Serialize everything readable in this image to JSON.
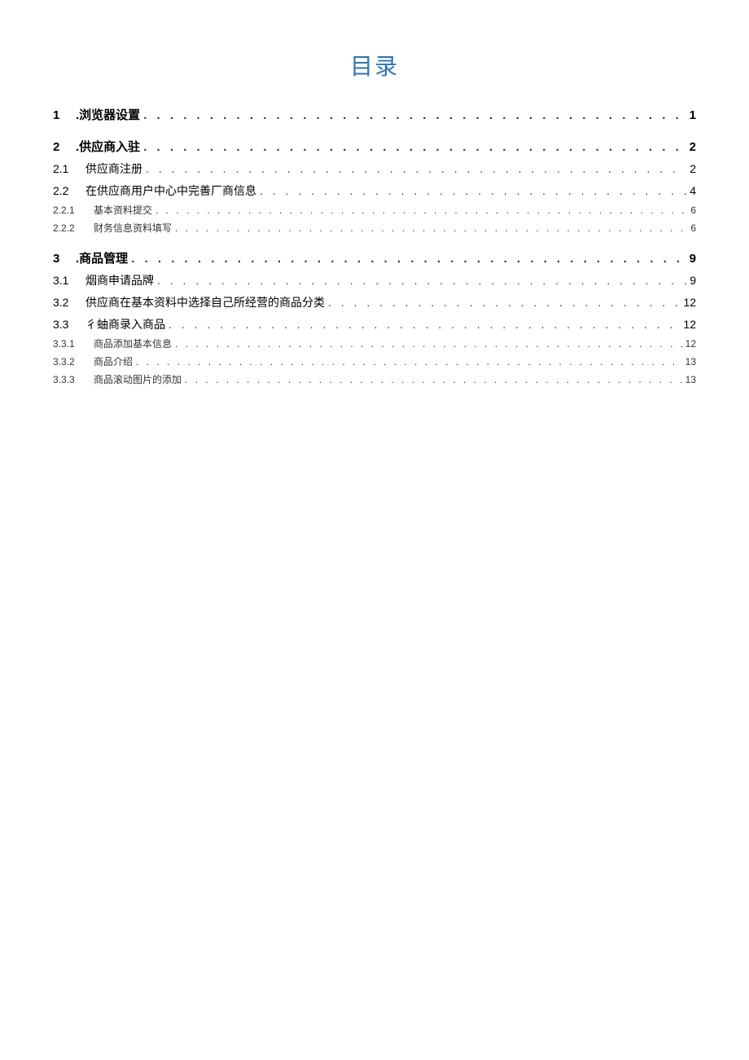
{
  "title": "目录",
  "leader": ". . . . . . . . . . . . . . . . . . . . . . . . . . . . . . . . . . . . . . . . . . . . . . . . . . . . . . . . . . . . . . . . . . . . . . . . . . . . . . . . . . . . . . . . . . . . . . . . . . . . . . . . . . . . . . . . . . . . . . . . . . . . . . . . . . . . . . . . . . . . . . . . . . . . . .",
  "entries": [
    {
      "level": 1,
      "num": "1",
      "dot": ".",
      "text": "浏览器设置",
      "page": "1"
    },
    {
      "level": 1,
      "num": "2",
      "dot": ". ",
      "text": "供应商入驻",
      "page": "2"
    },
    {
      "level": 2,
      "num": "2.1",
      "dot": "",
      "text": "供应商注册",
      "page": "2"
    },
    {
      "level": 2,
      "num": "2.2",
      "dot": "",
      "text": "在供应商用户中心中完善厂商信息",
      "page": "4"
    },
    {
      "level": 3,
      "num": "2.2.1",
      "dot": "",
      "text": "基本资料提交",
      "page": "6"
    },
    {
      "level": 3,
      "num": "2.2.2",
      "dot": "",
      "text": "财务信息资料填写",
      "page": "6"
    },
    {
      "level": 1,
      "num": "3",
      "dot": ".",
      "text": "商品管理",
      "page": "9"
    },
    {
      "level": 2,
      "num": "3.1",
      "dot": "",
      "text": "烟商申请品牌",
      "page": "9"
    },
    {
      "level": 2,
      "num": "3.2",
      "dot": "",
      "text": "供应商在基本资料中选择自己所经营的商品分类",
      "page": "12"
    },
    {
      "level": 2,
      "num": "3.3",
      "dot": "",
      "text": "彳蚰商录入商品",
      "page": "12"
    },
    {
      "level": 3,
      "num": "3.3.1",
      "dot": "",
      "text": "商品添加基本信息",
      "page": "12"
    },
    {
      "level": 3,
      "num": "3.3.2",
      "dot": "",
      "text": "商品介绍",
      "page": "13"
    },
    {
      "level": 3,
      "num": "3.3.3",
      "dot": "",
      "text": "商品滚动图片的添加",
      "page": "13"
    }
  ]
}
